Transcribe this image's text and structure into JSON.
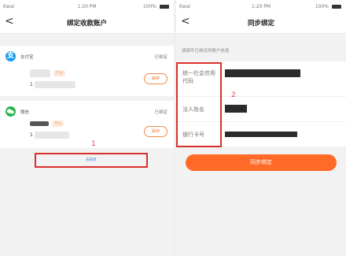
{
  "left_screen": {
    "status_bar": {
      "carrier": "Kwai",
      "time": "1:20 PM",
      "battery": "100%"
    },
    "nav": {
      "back": "<",
      "title": "绑定收款账户"
    },
    "alipay": {
      "logo": "支",
      "name": "支付宝",
      "status": "已绑定",
      "tag": "个人",
      "account_prefix": "1",
      "unbind": "解绑"
    },
    "wechat": {
      "name": "微信",
      "status": "已绑定",
      "tag": "个人",
      "account_prefix": "1",
      "unbind": "解绑"
    },
    "notice": {
      "text": "",
      "link": "去同步"
    }
  },
  "right_screen": {
    "status_bar": {
      "carrier": "Kwai",
      "time": "1:20 PM",
      "battery": "100%"
    },
    "nav": {
      "back": "<",
      "title": "同步绑定"
    },
    "hint": "请填写已绑定的账户信息",
    "fields": [
      {
        "label": "统一社会信用代码"
      },
      {
        "label": "法人姓名"
      },
      {
        "label": "银行卡号"
      }
    ],
    "submit": "同步绑定"
  },
  "callouts": {
    "one": "1",
    "two": "2"
  },
  "colors": {
    "accent": "#ff6a28",
    "highlight": "#d9302b",
    "alipay": "#1a9bec",
    "wechat": "#2bb24c"
  }
}
